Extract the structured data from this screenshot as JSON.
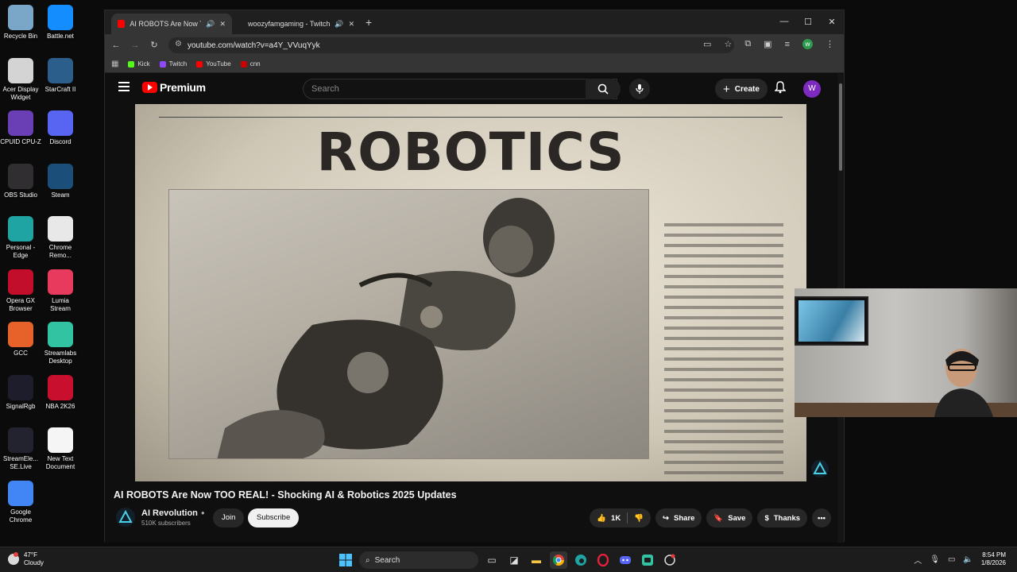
{
  "desktop": {
    "icons": [
      {
        "label": "Recycle Bin",
        "color": "#7aa7c7"
      },
      {
        "label": "Battle.net",
        "color": "#148eff"
      },
      {
        "label": "Acer Display\nWidget",
        "color": "#d4d4d4"
      },
      {
        "label": "StarCraft II",
        "color": "#2b5e8a"
      },
      {
        "label": "CPUID CPU-Z",
        "color": "#6a3fb5"
      },
      {
        "label": "Discord",
        "color": "#5865f2"
      },
      {
        "label": "OBS Studio",
        "color": "#302e31"
      },
      {
        "label": "Steam",
        "color": "#1b4f7a"
      },
      {
        "label": "Personal -\nEdge",
        "color": "#1fa3a3"
      },
      {
        "label": "Chrome\nRemo...",
        "color": "#e8e8e8"
      },
      {
        "label": "Opera GX\nBrowser",
        "color": "#c20d2b"
      },
      {
        "label": "Lumia\nStream",
        "color": "#e83a5c"
      },
      {
        "label": "GCC",
        "color": "#e7622a"
      },
      {
        "label": "Streamlabs\nDesktop",
        "color": "#31c3a2"
      },
      {
        "label": "SignalRgb",
        "color": "#1d1d2b"
      },
      {
        "label": "NBA 2K26",
        "color": "#c8102e"
      },
      {
        "label": "StreamEle...\nSE.Live",
        "color": "#23232f"
      },
      {
        "label": "New Text\nDocument",
        "color": "#f5f5f5"
      },
      {
        "label": "Google\nChrome",
        "color": "#4285f4"
      }
    ]
  },
  "browser": {
    "tabs": [
      {
        "title": "AI ROBOTS Are Now TOO R",
        "favicon_color": "#ff0000",
        "active": true
      },
      {
        "title": "woozyfamgaming - Twitch",
        "favicon_color": "#9146ff",
        "active": false
      }
    ],
    "url": "youtube.com/watch?v=a4Y_VVuqYyk",
    "bookmarks": [
      {
        "label": "Kick",
        "color": "#53fc18"
      },
      {
        "label": "Twitch",
        "color": "#9146ff"
      },
      {
        "label": "YouTube",
        "color": "#ff0000"
      },
      {
        "label": "cnn",
        "color": "#cc0000"
      }
    ],
    "profile_initial": "w"
  },
  "youtube": {
    "logo_text": "Premium",
    "search_placeholder": "Search",
    "create_label": "Create",
    "avatar_initial": "W",
    "video": {
      "headline": "ROBOTICS",
      "title": "AI ROBOTS Are Now TOO REAL! - Shocking AI & Robotics 2025 Updates"
    },
    "channel": {
      "name": "AI Revolution",
      "subscribers": "510K subscribers"
    },
    "join_label": "Join",
    "subscribe_label": "Subscribe",
    "actions": {
      "likes": "1K",
      "share": "Share",
      "save": "Save",
      "thanks": "Thanks"
    }
  },
  "taskbar": {
    "weather_temp": "47°F",
    "weather_desc": "Cloudy",
    "search_label": "Search",
    "time": "8:54 PM",
    "date": "1/8/2026"
  }
}
